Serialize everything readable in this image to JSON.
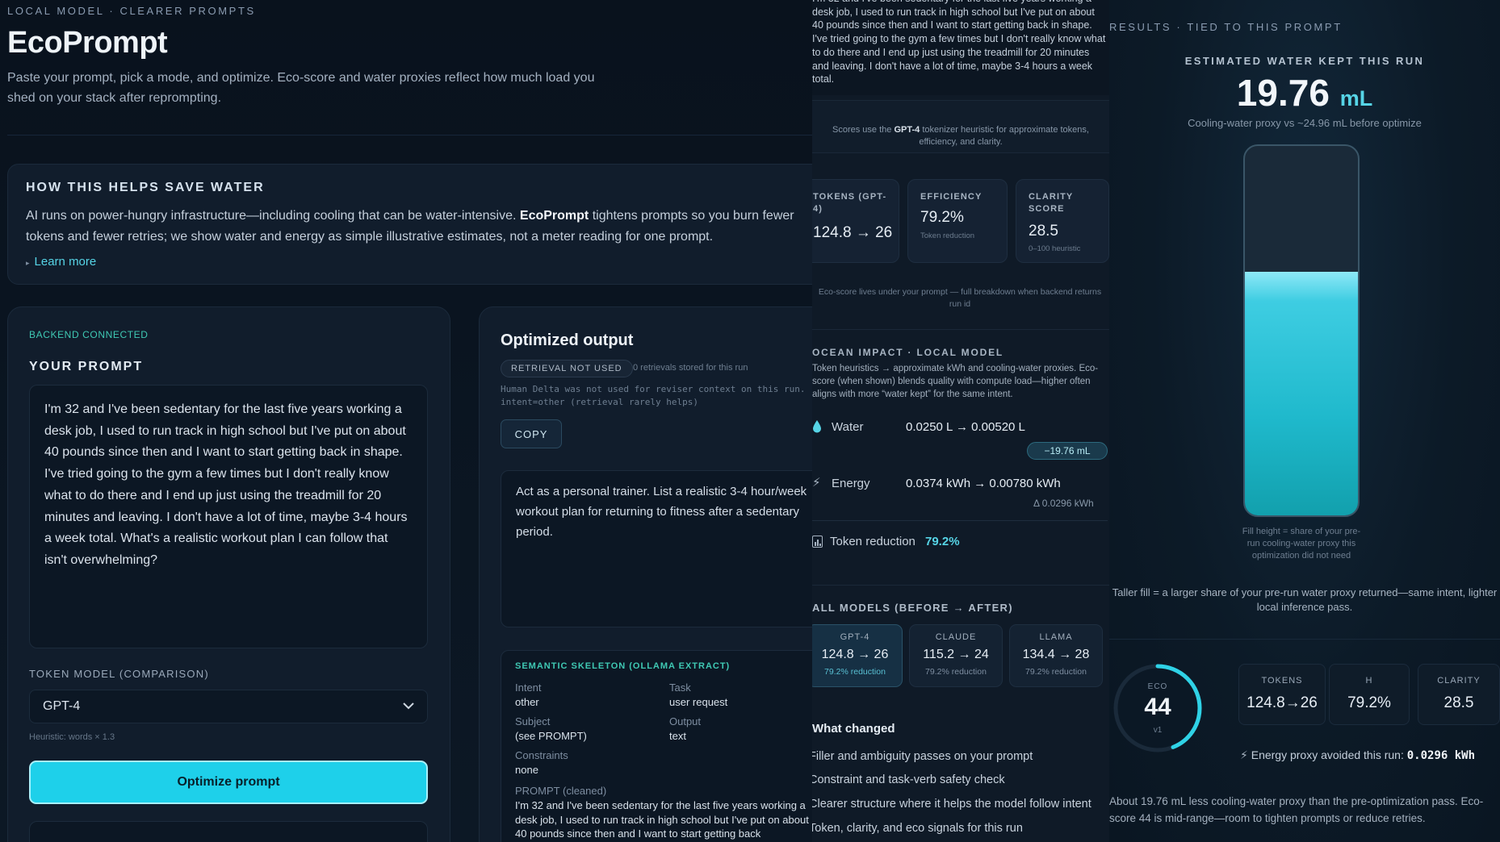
{
  "header": {
    "kicker": "LOCAL MODEL · CLEARER PROMPTS",
    "title": "EcoPrompt",
    "subtitle": "Paste your prompt, pick a mode, and optimize. Eco-score and water proxies reflect how much load you shed on your stack after reprompting."
  },
  "water_help": {
    "heading": "HOW THIS HELPS SAVE WATER",
    "body_pre": "AI runs on power-hungry infrastructure—including cooling that can be water-intensive.",
    "body_brand": "EcoPrompt",
    "body_post": "tightens prompts so you burn fewer tokens and fewer retries; we show water and energy as simple illustrative estimates, not a meter reading for one prompt.",
    "learn_more": "Learn more"
  },
  "prompt_panel": {
    "status": "BACKEND CONNECTED",
    "heading": "YOUR PROMPT",
    "prompt_text": "I'm 32 and I've been sedentary for the last five years working a desk job, I used to run track in high school but I've put on about 40 pounds since then and I want to start getting back in shape. I've tried going to the gym a few times but I don't really know what to do there and I end up just using the treadmill for 20 minutes and leaving. I don't have a lot of time, maybe 3-4 hours a week total. What's a realistic workout plan I can follow that isn't overwhelming?",
    "token_model_label": "TOKEN MODEL (COMPARISON)",
    "token_model_value": "GPT-4",
    "heuristic": "Heuristic: words × 1.3",
    "optimize_label": "Optimize prompt"
  },
  "output_panel": {
    "title": "Optimized output",
    "retrieval_badge": "RETRIEVAL NOT USED",
    "retrieval_count": "0 retrievals stored for this run",
    "human_delta": "Human Delta was not used for reviser context on this run. · intent=other (retrieval rarely helps)",
    "copy_label": "COPY",
    "optimized_text": "Act as a personal trainer. List a realistic 3-4 hour/week workout plan for returning to fitness after a sedentary period.",
    "skeleton": {
      "heading": "SEMANTIC SKELETON (OLLAMA EXTRACT)",
      "intent_label": "Intent",
      "intent_value": "other",
      "task_label": "Task",
      "task_value": "user request",
      "subject_label": "Subject",
      "subject_value": "(see PROMPT)",
      "output_label": "Output",
      "output_value": "text",
      "constraints_label": "Constraints",
      "constraints_value": "none",
      "prompt_label": "PROMPT (cleaned)",
      "prompt_value": "I'm 32 and I've been sedentary for the last five years working a desk job, I used to run track in high school but I've put on about 40 pounds since then and I want to start getting back"
    }
  },
  "middle": {
    "top_text": "I'm 32 and I've been sedentary for the last five years working a desk job, I used to run track in high school but I've put on about 40 pounds since then and I want to start getting back in shape. I've tried going to the gym a few times but I don't really know what to do there and I end up just using the treadmill for 20 minutes and leaving. I don't have a lot of time, maybe 3-4 hours a week total.",
    "scores_note_pre": "Scores use the",
    "scores_note_model": "GPT-4",
    "scores_note_post": "tokenizer heuristic for approximate tokens, efficiency, and clarity.",
    "tiles": [
      {
        "label": "TOKENS (GPT-4)",
        "value": "124.8 → 26",
        "sub": ""
      },
      {
        "label": "EFFICIENCY",
        "value": "79.2%",
        "sub": "Token reduction"
      },
      {
        "label": "CLARITY SCORE",
        "value": "28.5",
        "sub": "0–100 heuristic"
      }
    ],
    "eco_note": "Eco-score lives under your prompt — full breakdown when backend returns run id",
    "ocean_heading": "OCEAN IMPACT · LOCAL MODEL",
    "ocean_desc": "Token heuristics → approximate kWh and cooling-water proxies. Eco-score (when shown) blends quality with compute load—higher often aligns with more “water kept” for the same intent.",
    "water_label": "Water",
    "water_value": "0.0250 L → 0.00520 L",
    "water_delta": "−19.76 mL",
    "energy_label": "Energy",
    "energy_value": "0.0374 kWh → 0.00780 kWh",
    "energy_delta": "Δ 0.0296 kWh",
    "token_reduction_label": "Token reduction",
    "token_reduction_value": "79.2%",
    "all_models_heading": "ALL MODELS (BEFORE → AFTER)",
    "models": [
      {
        "name": "GPT-4",
        "value": "124.8 → 26",
        "reduction": "79.2% reduction"
      },
      {
        "name": "CLAUDE",
        "value": "115.2 → 24",
        "reduction": "79.2% reduction"
      },
      {
        "name": "LLAMA",
        "value": "134.4 → 28",
        "reduction": "79.2% reduction"
      }
    ],
    "what_changed": "What changed",
    "changes": [
      "Filler and ambiguity passes on your prompt",
      "Constraint and task-verb safety check",
      "Clearer structure where it helps the model follow intent",
      "Token, clarity, and eco signals for this run"
    ]
  },
  "results": {
    "kicker": "RESULTS · TIED TO THIS PROMPT",
    "est_heading": "ESTIMATED WATER KEPT THIS RUN",
    "big_value": "19.76",
    "big_unit": "mL",
    "cooling_note": "Cooling-water proxy vs ~24.96 mL before optimize",
    "tank_fill_fraction": 0.66,
    "fill_note": "Fill height = share of your pre-run cooling-water proxy this optimization did not need",
    "taller_note": "Taller fill = a larger share of your pre-run water proxy returned—same intent, lighter local inference pass.",
    "eco_label": "ECO",
    "eco_score": "44",
    "eco_version": "v1",
    "eco_score_fraction": 0.44,
    "tiles": [
      {
        "label": "TOKENS",
        "value": "124.8→26"
      },
      {
        "label": "H",
        "value": "79.2%"
      },
      {
        "label": "CLARITY",
        "value": "28.5"
      }
    ],
    "energy_avoided_label": "Energy proxy avoided this run:",
    "energy_avoided_value": "0.0296 kWh",
    "summary": "About 19.76 mL less cooling-water proxy than the pre-optimization pass. Eco-score 44 is mid-range—room to tighten prompts or reduce retries."
  },
  "colors": {
    "accent": "#1ed0ea",
    "teal_text": "#3fc9b4",
    "background": "#0a1421"
  }
}
